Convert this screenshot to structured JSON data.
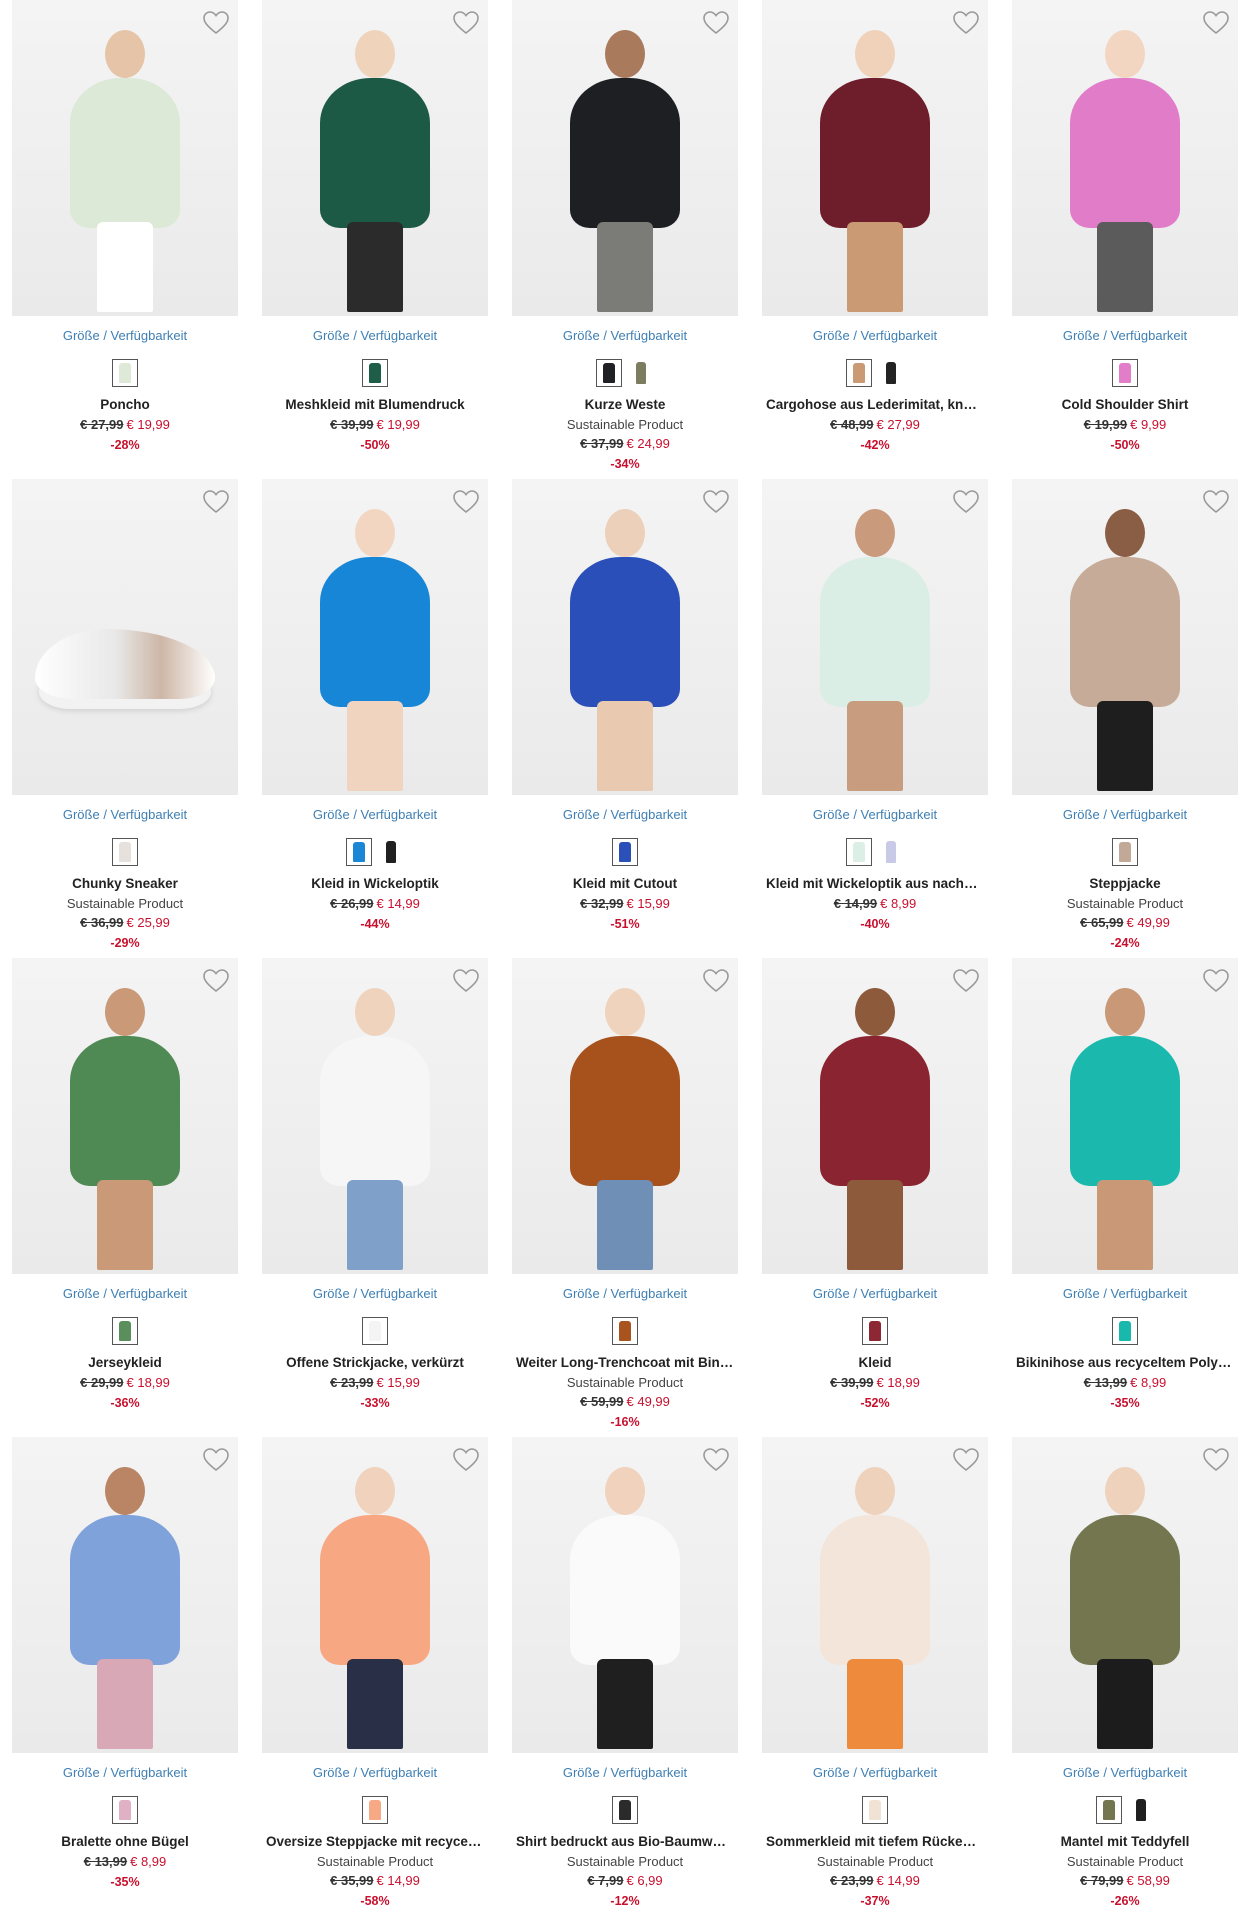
{
  "ui": {
    "availability_label": "Größe / Verfügbarkeit"
  },
  "products": [
    {
      "name": "Poncho",
      "sustainable": "",
      "old_price": "€ 27,99",
      "new_price": "€ 19,99",
      "discount": "-28%",
      "garment": "#dce9d6",
      "legs": "#ffffff",
      "skin": "#e6c4a8",
      "swatches": [
        "#dfe9d8"
      ]
    },
    {
      "name": "Meshkleid mit Blumendruck",
      "sustainable": "",
      "old_price": "€ 39,99",
      "new_price": "€ 19,99",
      "discount": "-50%",
      "garment": "#1d5a45",
      "legs": "#2b2b2b",
      "skin": "#efd3bb",
      "swatches": [
        "#1e5d47"
      ]
    },
    {
      "name": "Kurze Weste",
      "sustainable": "Sustainable Product",
      "old_price": "€ 37,99",
      "new_price": "€ 24,99",
      "discount": "-34%",
      "garment": "#1d1f23",
      "legs": "#7b7b78",
      "skin": "#a97a5c",
      "swatches": [
        "#1f2125",
        "#7b7d5e"
      ]
    },
    {
      "name": "Cargohose aus Lederimitat, knöchelfrei",
      "sustainable": "",
      "old_price": "€ 48,99",
      "new_price": "€ 27,99",
      "discount": "-42%",
      "garment": "#6e1d2a",
      "legs": "#c99a74",
      "skin": "#f0d2bb",
      "swatches": [
        "#c99a74",
        "#232323"
      ]
    },
    {
      "name": "Cold Shoulder Shirt",
      "sustainable": "",
      "old_price": "€ 19,99",
      "new_price": "€ 9,99",
      "discount": "-50%",
      "garment": "#e17cc8",
      "legs": "#5b5b5b",
      "skin": "#f2d6c2",
      "swatches": [
        "#e27ec9"
      ]
    },
    {
      "name": "Chunky Sneaker",
      "sustainable": "Sustainable Product",
      "old_price": "€ 36,99",
      "new_price": "€ 25,99",
      "discount": "-29%",
      "garment": "#efefef",
      "legs": "#cdb6a6",
      "skin": "#ffffff",
      "swatches": [
        "#e6e1dd"
      ]
    },
    {
      "name": "Kleid in Wickeloptik",
      "sustainable": "",
      "old_price": "€ 26,99",
      "new_price": "€ 14,99",
      "discount": "-44%",
      "garment": "#1786d6",
      "legs": "#f0d4bf",
      "skin": "#f2d6c2",
      "swatches": [
        "#1b86d6",
        "#202020"
      ]
    },
    {
      "name": "Kleid mit Cutout",
      "sustainable": "",
      "old_price": "€ 32,99",
      "new_price": "€ 15,99",
      "discount": "-51%",
      "garment": "#2a4fb8",
      "legs": "#e9c9b0",
      "skin": "#ecd0ba",
      "swatches": [
        "#2b50b8"
      ]
    },
    {
      "name": "Kleid mit Wickeloptik aus nachhaltiger Viskose",
      "sustainable": "",
      "old_price": "€ 14,99",
      "new_price": "€ 8,99",
      "discount": "-40%",
      "garment": "#dbeee6",
      "legs": "#c79c7f",
      "skin": "#c99a7c",
      "swatches": [
        "#dcefe7",
        "#c9c9e8"
      ]
    },
    {
      "name": "Steppjacke",
      "sustainable": "Sustainable Product",
      "old_price": "€ 65,99",
      "new_price": "€ 49,99",
      "discount": "-24%",
      "garment": "#c5ab98",
      "legs": "#1e1e1e",
      "skin": "#8a5e45",
      "swatches": [
        "#c2a997"
      ]
    },
    {
      "name": "Jerseykleid",
      "sustainable": "",
      "old_price": "€ 29,99",
      "new_price": "€ 18,99",
      "discount": "-36%",
      "garment": "#4f8a54",
      "legs": "#c99978",
      "skin": "#c99978",
      "swatches": [
        "#5a8f5c"
      ]
    },
    {
      "name": "Offene Strickjacke, verkürzt",
      "sustainable": "",
      "old_price": "€ 23,99",
      "new_price": "€ 15,99",
      "discount": "-33%",
      "garment": "#f6f6f6",
      "legs": "#7fa0c8",
      "skin": "#efd3bd",
      "swatches": [
        "#f4f4f4"
      ]
    },
    {
      "name": "Weiter Long-Trenchcoat mit Bindeband",
      "sustainable": "Sustainable Product",
      "old_price": "€ 59,99",
      "new_price": "€ 49,99",
      "discount": "-16%",
      "garment": "#a7511c",
      "legs": "#6f8fb7",
      "skin": "#efd3bd",
      "swatches": [
        "#a9541e"
      ]
    },
    {
      "name": "Kleid",
      "sustainable": "",
      "old_price": "€ 39,99",
      "new_price": "€ 18,99",
      "discount": "-52%",
      "garment": "#8a2430",
      "legs": "#8d5a3c",
      "skin": "#8d5a3c",
      "swatches": [
        "#8c2733"
      ]
    },
    {
      "name": "Bikinihose aus recyceltem Polyamid",
      "sustainable": "",
      "old_price": "€ 13,99",
      "new_price": "€ 8,99",
      "discount": "-35%",
      "garment": "#1bb9ad",
      "legs": "#c89877",
      "skin": "#c89877",
      "swatches": [
        "#19b8ad"
      ]
    },
    {
      "name": "Bralette ohne Bügel",
      "sustainable": "",
      "old_price": "€ 13,99",
      "new_price": "€ 8,99",
      "discount": "-35%",
      "garment": "#7fa2da",
      "legs": "#d9a8b7",
      "skin": "#b98565",
      "swatches": [
        "#e0b0c4"
      ]
    },
    {
      "name": "Oversize Steppjacke mit recyceltem Polyester",
      "sustainable": "Sustainable Product",
      "old_price": "€ 35,99",
      "new_price": "€ 14,99",
      "discount": "-58%",
      "garment": "#f7a883",
      "legs": "#2a2f48",
      "skin": "#f0d2bd",
      "swatches": [
        "#f7a985"
      ]
    },
    {
      "name": "Shirt bedruckt aus Bio-Baumwolle",
      "sustainable": "Sustainable Product",
      "old_price": "€ 7,99",
      "new_price": "€ 6,99",
      "discount": "-12%",
      "garment": "#fafafa",
      "legs": "#1f1f1f",
      "skin": "#f0d2bd",
      "swatches": [
        "#2b2b2b"
      ]
    },
    {
      "name": "Sommerkleid mit tiefem Rückenausschnitt",
      "sustainable": "Sustainable Product",
      "old_price": "€ 23,99",
      "new_price": "€ 14,99",
      "discount": "-37%",
      "garment": "#f3e5d9",
      "legs": "#ee8a3c",
      "skin": "#efd2bc",
      "swatches": [
        "#f1e2d6"
      ]
    },
    {
      "name": "Mantel mit Teddyfell",
      "sustainable": "Sustainable Product",
      "old_price": "€ 79,99",
      "new_price": "€ 58,99",
      "discount": "-26%",
      "garment": "#747650",
      "legs": "#1c1c1c",
      "skin": "#efd2bc",
      "swatches": [
        "#74764f",
        "#1f1f1f"
      ]
    }
  ]
}
